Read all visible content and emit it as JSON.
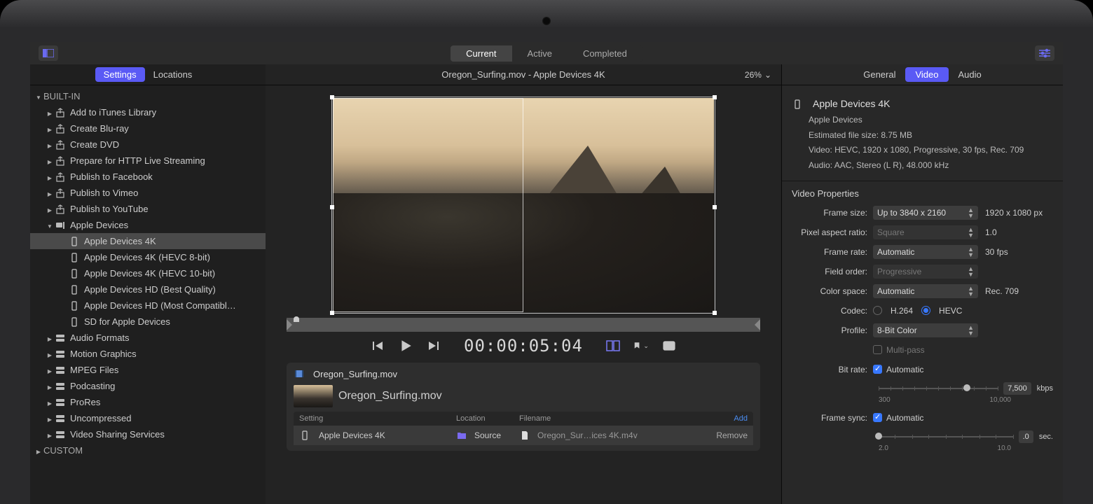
{
  "topbar": {
    "tabs": {
      "current": "Current",
      "active": "Active",
      "completed": "Completed"
    }
  },
  "sidebar": {
    "tabs": {
      "settings": "Settings",
      "locations": "Locations"
    },
    "groups": {
      "builtin": "BUILT-IN",
      "custom": "CUSTOM"
    },
    "items": {
      "itunes": "Add to iTunes Library",
      "bluray": "Create Blu-ray",
      "dvd": "Create DVD",
      "hls": "Prepare for HTTP Live Streaming",
      "facebook": "Publish to Facebook",
      "vimeo": "Publish to Vimeo",
      "youtube": "Publish to YouTube",
      "apple": "Apple Devices",
      "apple_4k": "Apple Devices 4K",
      "apple_4k_hevc8": "Apple Devices 4K (HEVC 8-bit)",
      "apple_4k_hevc10": "Apple Devices 4K (HEVC 10-bit)",
      "apple_hd_best": "Apple Devices HD (Best Quality)",
      "apple_hd_compat": "Apple Devices HD (Most Compatibl…",
      "apple_sd": "SD for Apple Devices",
      "audio": "Audio Formats",
      "motion": "Motion Graphics",
      "mpeg": "MPEG Files",
      "podcast": "Podcasting",
      "prores": "ProRes",
      "uncompressed": "Uncompressed",
      "sharing": "Video Sharing Services"
    }
  },
  "center": {
    "title": "Oregon_Surfing.mov - Apple Devices 4K",
    "zoom": "26%",
    "timecode": "00:00:05:04"
  },
  "batch": {
    "filename": "Oregon_Surfing.mov",
    "item_name": "Oregon_Surfing.mov",
    "columns": {
      "setting": "Setting",
      "location": "Location",
      "filename": "Filename",
      "add": "Add"
    },
    "row": {
      "setting": "Apple Devices 4K",
      "location": "Source",
      "filename": "Oregon_Sur…ices 4K.m4v",
      "remove": "Remove"
    }
  },
  "inspector": {
    "tabs": {
      "general": "General",
      "video": "Video",
      "audio": "Audio"
    },
    "summary": {
      "title": "Apple Devices 4K",
      "subtitle": "Apple Devices",
      "filesize": "Estimated file size: 8.75 MB",
      "video": "Video: HEVC, 1920 x 1080, Progressive, 30 fps, Rec. 709",
      "audio": "Audio: AAC, Stereo (L R), 48.000 kHz"
    },
    "section": "Video Properties",
    "props": {
      "frame_size_lbl": "Frame size:",
      "frame_size_sel": "Up to 3840 x 2160",
      "frame_size_val": "1920 x 1080 px",
      "par_lbl": "Pixel aspect ratio:",
      "par_sel": "Square",
      "par_val": "1.0",
      "fps_lbl": "Frame rate:",
      "fps_sel": "Automatic",
      "fps_val": "30 fps",
      "field_lbl": "Field order:",
      "field_sel": "Progressive",
      "cs_lbl": "Color space:",
      "cs_sel": "Automatic",
      "cs_val": "Rec. 709",
      "codec_lbl": "Codec:",
      "codec_h264": "H.264",
      "codec_hevc": "HEVC",
      "profile_lbl": "Profile:",
      "profile_sel": "8-Bit Color",
      "multipass": "Multi-pass",
      "bitrate_lbl": "Bit rate:",
      "bitrate_auto": "Automatic",
      "bitrate_val": "7,500",
      "bitrate_unit": "kbps",
      "bitrate_min": "300",
      "bitrate_max": "10,000",
      "fsync_lbl": "Frame sync:",
      "fsync_auto": "Automatic",
      "fsync_val": ".0",
      "fsync_unit": "sec.",
      "fsync_min": "2.0",
      "fsync_max": "10.0"
    }
  }
}
